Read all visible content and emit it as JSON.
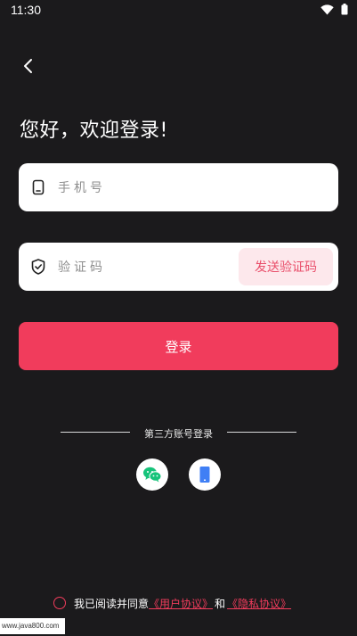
{
  "status_bar": {
    "time": "11:30",
    "icons": [
      "wifi-icon",
      "battery-icon"
    ]
  },
  "header": {
    "back_icon": "chevron-left-icon",
    "greeting": "您好，欢迎登录!"
  },
  "form": {
    "phone": {
      "icon": "phone-outline-icon",
      "placeholder": "手机号",
      "value": ""
    },
    "code": {
      "icon": "shield-check-icon",
      "placeholder": "验证码",
      "value": "",
      "send_label": "发送验证码"
    },
    "login_label": "登录"
  },
  "third_party": {
    "label": "第三方账号登录",
    "options": [
      {
        "icon": "wechat-icon"
      },
      {
        "icon": "mobile-phone-icon"
      }
    ]
  },
  "agreement": {
    "prefix": "我已阅读并同意",
    "user_agreement": "《用户协议》",
    "and": "和",
    "privacy_policy": "《隐私协议》",
    "checked": false
  },
  "watermark": "www.java800.com",
  "colors": {
    "background": "#1b1a1c",
    "accent": "#f13c5c",
    "send_code_bg": "#fde8ec",
    "send_code_text": "#e94f6b"
  }
}
